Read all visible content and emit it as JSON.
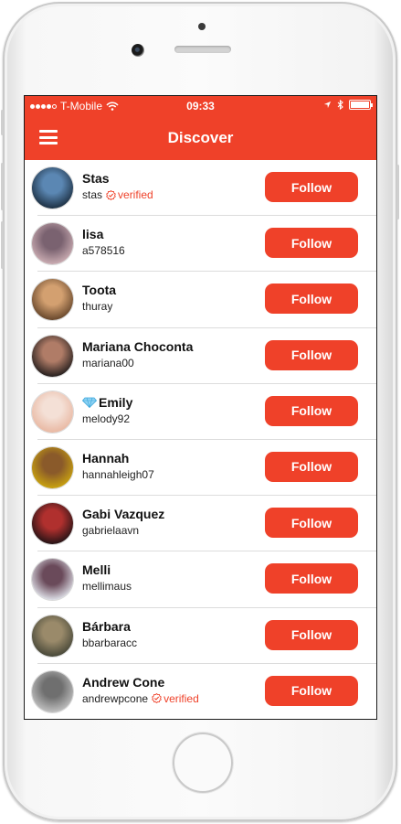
{
  "status_bar": {
    "carrier": "T-Mobile",
    "time": "09:33"
  },
  "nav": {
    "title": "Discover",
    "menu_icon": "hamburger-menu-icon"
  },
  "colors": {
    "accent": "#ef4129",
    "text": "#111111"
  },
  "users": [
    {
      "name": "Stas",
      "handle": "stas",
      "badge": "verified",
      "avatar_colors": [
        "#1f3347",
        "#5b87b3"
      ],
      "follow_label": "Follow"
    },
    {
      "name": "lisa",
      "handle": "a578516",
      "badge": "",
      "avatar_colors": [
        "#c8aab0",
        "#7a6270"
      ],
      "follow_label": "Follow"
    },
    {
      "name": "Toota",
      "handle": "thuray",
      "badge": "",
      "avatar_colors": [
        "#6b4a2e",
        "#d3a070"
      ],
      "follow_label": "Follow"
    },
    {
      "name": "Mariana Choconta",
      "handle": "mariana00",
      "badge": "",
      "avatar_colors": [
        "#2a2220",
        "#b07c67"
      ],
      "follow_label": "Follow"
    },
    {
      "name": "Emily",
      "handle": "melody92",
      "badge": "",
      "avatar_colors": [
        "#e9b9a4",
        "#f4e0d6"
      ],
      "follow_label": "Follow"
    },
    {
      "name": "Hannah",
      "handle": "hannahleigh07",
      "badge": "",
      "avatar_colors": [
        "#c7a010",
        "#8a5a2a"
      ],
      "follow_label": "Follow"
    },
    {
      "name": "Gabi Vazquez",
      "handle": "gabrielaavn",
      "badge": "",
      "avatar_colors": [
        "#2a1416",
        "#b0302e"
      ],
      "follow_label": "Follow"
    },
    {
      "name": "Melli",
      "handle": "mellimaus",
      "badge": "",
      "avatar_colors": [
        "#d8d8e0",
        "#6a4a5a"
      ],
      "follow_label": "Follow"
    },
    {
      "name": "Bárbara",
      "handle": "bbarbaracc",
      "badge": "",
      "avatar_colors": [
        "#4a4a3a",
        "#9a8a6a"
      ],
      "follow_label": "Follow"
    },
    {
      "name": "Andrew Cone",
      "handle": "andrewpcone",
      "badge": "verified",
      "avatar_colors": [
        "#bdbdbd",
        "#6f6f6f"
      ],
      "follow_label": "Follow"
    }
  ]
}
